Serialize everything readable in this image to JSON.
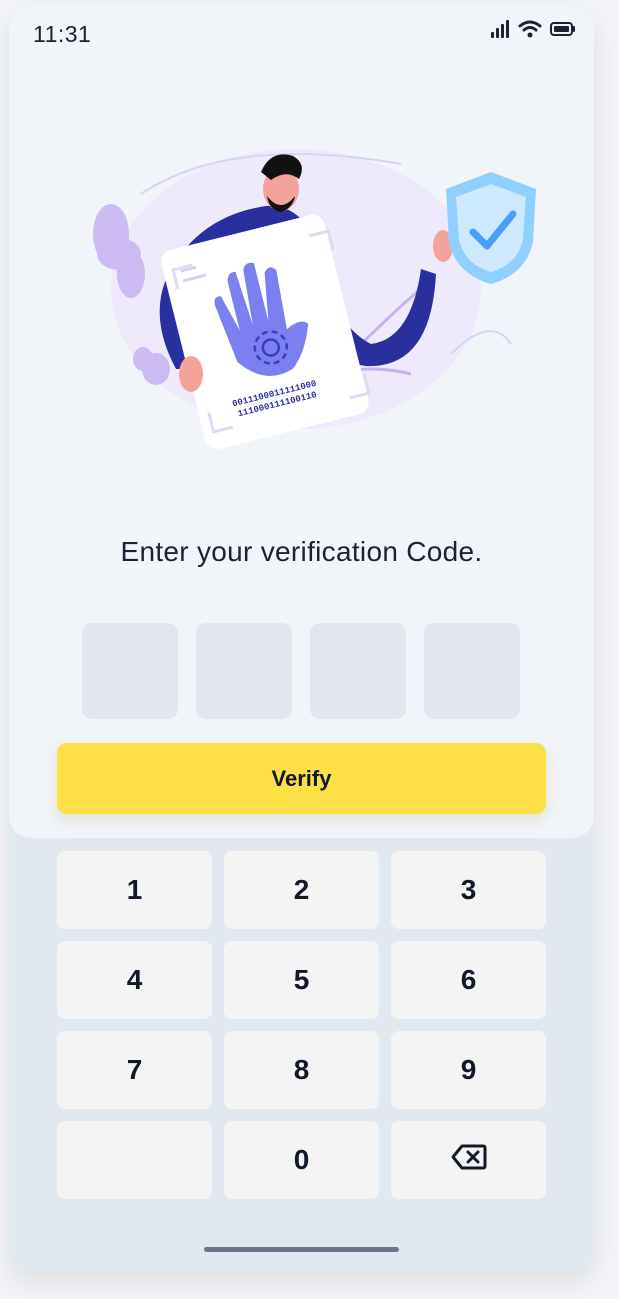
{
  "status_bar": {
    "time": "11:31",
    "icons": [
      "signal-icon",
      "wifi-icon",
      "battery-icon"
    ]
  },
  "illustration": {
    "binary_line_1": "0011100011111000",
    "binary_line_2": "111000111100110"
  },
  "prompt": "Enter your verification Code.",
  "code_boxes": [
    "",
    "",
    "",
    ""
  ],
  "verify_button": "Verify",
  "keypad": {
    "keys": [
      "1",
      "2",
      "3",
      "4",
      "5",
      "6",
      "7",
      "8",
      "9",
      "",
      "0",
      "backspace-icon"
    ]
  },
  "colors": {
    "accent": "#fce046",
    "panel": "#f1f4f9",
    "keypad_bg": "#e2e8f0",
    "key_bg": "#f4f4f5",
    "hand_card_purple": "#2a2f9e"
  }
}
